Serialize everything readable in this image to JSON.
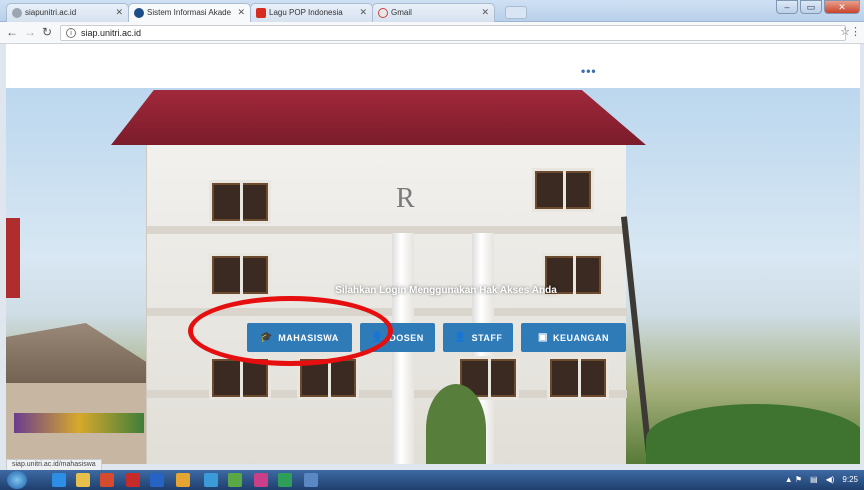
{
  "browser": {
    "tabs": [
      {
        "title": "siapunitri.ac.id",
        "favicon_color": "#9aa6b3"
      },
      {
        "title": "Sistem Informasi Akade",
        "favicon_color": "#1e4e8a"
      },
      {
        "title": "Lagu POP Indonesia",
        "favicon_color": "#d62d20"
      },
      {
        "title": "Gmail",
        "favicon_color": "#e8e8e8"
      }
    ],
    "active_tab_index": 1,
    "address": "siap.unitri.ac.id",
    "status_url": "siap.unitri.ac.id/mahasiswa"
  },
  "site": {
    "header_dots": "•••",
    "tagline": "Silahkan Login Menggunakan Hak Akses Anda",
    "buttons": [
      {
        "label": "MAHASISWA",
        "icon": "graduation-cap-icon",
        "glyph": "🎓"
      },
      {
        "label": "DOSEN",
        "icon": "user-tie-icon",
        "glyph": "👤"
      },
      {
        "label": "STAFF",
        "icon": "user-icon",
        "glyph": "👤"
      },
      {
        "label": "KEUANGAN",
        "icon": "money-icon",
        "glyph": "▣"
      }
    ],
    "highlight_color": "#e50f0f",
    "button_color": "#2f7bb8"
  },
  "taskbar": {
    "clock": "9:25",
    "tray_icons": [
      "flag-icon",
      "network-icon",
      "volume-icon"
    ]
  }
}
